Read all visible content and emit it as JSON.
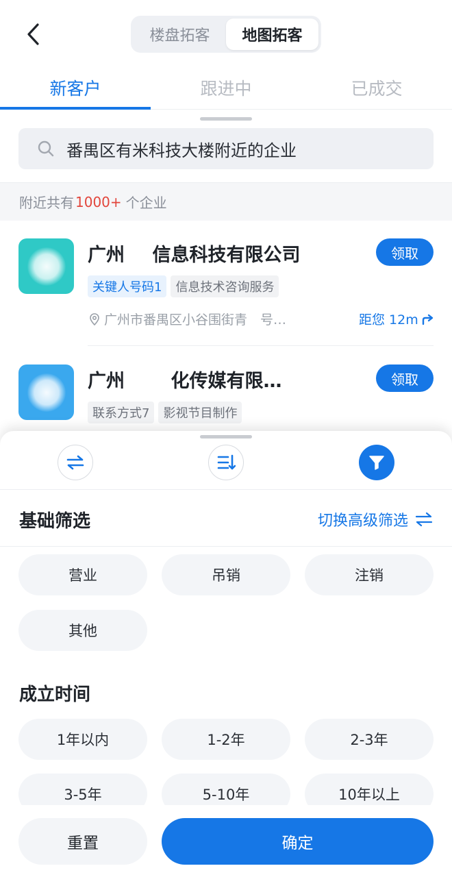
{
  "header": {
    "segments": [
      "楼盘拓客",
      "地图拓客"
    ],
    "active_segment": 1,
    "tabs": [
      "新客户",
      "跟进中",
      "已成交"
    ]
  },
  "search": {
    "query": "番禺区有米科技大楼附近的企业"
  },
  "summary": {
    "prefix": "附近共有",
    "count": "1000+",
    "suffix": "个企业"
  },
  "companies": [
    {
      "name": "广州   信息科技有限公司",
      "claim_label": "领取",
      "tags": [
        "关键人号码1",
        "信息技术咨询服务"
      ],
      "address": "广州市番禺区小谷围街青  号…",
      "distance": "距您 12m"
    },
    {
      "name": "广州     化传媒有限…",
      "claim_label": "领取",
      "tags": [
        "联系方式7",
        "影视节目制作"
      ]
    }
  ],
  "filter": {
    "section_title": "基础筛选",
    "advanced_link": "切换高级筛选",
    "status_options": [
      "营业",
      "吊销",
      "注销",
      "其他"
    ],
    "time_title": "成立时间",
    "time_options": [
      "1年以内",
      "1-2年",
      "2-3年",
      "3-5年",
      "5-10年",
      "10年以上"
    ],
    "reset_label": "重置",
    "confirm_label": "确定"
  },
  "colors": {
    "accent": "#1677e6",
    "count_highlight": "#e2463c"
  }
}
